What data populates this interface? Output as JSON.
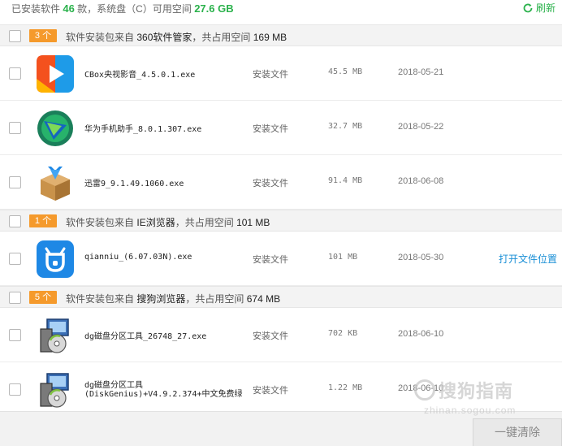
{
  "header": {
    "installed_prefix": "已安装软件",
    "installed_count": "46",
    "installed_suffix": "款，系统盘（C）可用空间",
    "free_space": "27.6 GB",
    "refresh_label": "刷新"
  },
  "groups": [
    {
      "badge": "3 个",
      "source_prefix": "软件安装包来自",
      "source": "360软件管家",
      "space_text": "，共占用空间",
      "space": "169 MB",
      "items": [
        {
          "name": "CBox央视影音_4.5.0.1.exe",
          "type": "安装文件",
          "size": "45.5 MB",
          "date": "2018-05-21",
          "icon": "cbox-icon"
        },
        {
          "name": "华为手机助手_8.0.1.307.exe",
          "type": "安装文件",
          "size": "32.7 MB",
          "date": "2018-05-22",
          "icon": "huawei-hisuite-icon"
        },
        {
          "name": "迅雷9_9.1.49.1060.exe",
          "type": "安装文件",
          "size": "91.4 MB",
          "date": "2018-06-08",
          "icon": "xunlei-icon"
        }
      ]
    },
    {
      "badge": "1 个",
      "source_prefix": "软件安装包来自",
      "source": "IE浏览器",
      "space_text": "，共占用空间",
      "space": "101 MB",
      "items": [
        {
          "name": "qianniu_(6.07.03N).exe",
          "type": "安装文件",
          "size": "101 MB",
          "date": "2018-05-30",
          "icon": "qianniu-icon",
          "action": "打开文件位置"
        }
      ]
    },
    {
      "badge": "5 个",
      "source_prefix": "软件安装包来自",
      "source": "搜狗浏览器",
      "space_text": "，共占用空间",
      "space": "674 MB",
      "items": [
        {
          "name": "dg磁盘分区工具_26748_27.exe",
          "type": "安装文件",
          "size": "702 KB",
          "date": "2018-06-10",
          "icon": "installer-disk-icon"
        },
        {
          "name": "dg磁盘分区工具",
          "name2": "(DiskGenius)+V4.9.2.374+中文免费绿",
          "type": "安装文件",
          "size": "1.22 MB",
          "date": "2018-06-10",
          "icon": "installer-disk-icon"
        }
      ]
    }
  ],
  "footer": {
    "clean_label": "一键清除"
  },
  "watermark": {
    "line1": "搜狗指南",
    "line2": "zhinan.sogou.com"
  },
  "colors": {
    "accent_green": "#2bb24c",
    "badge_orange": "#f59a2c",
    "link_blue": "#1a8fd6"
  }
}
